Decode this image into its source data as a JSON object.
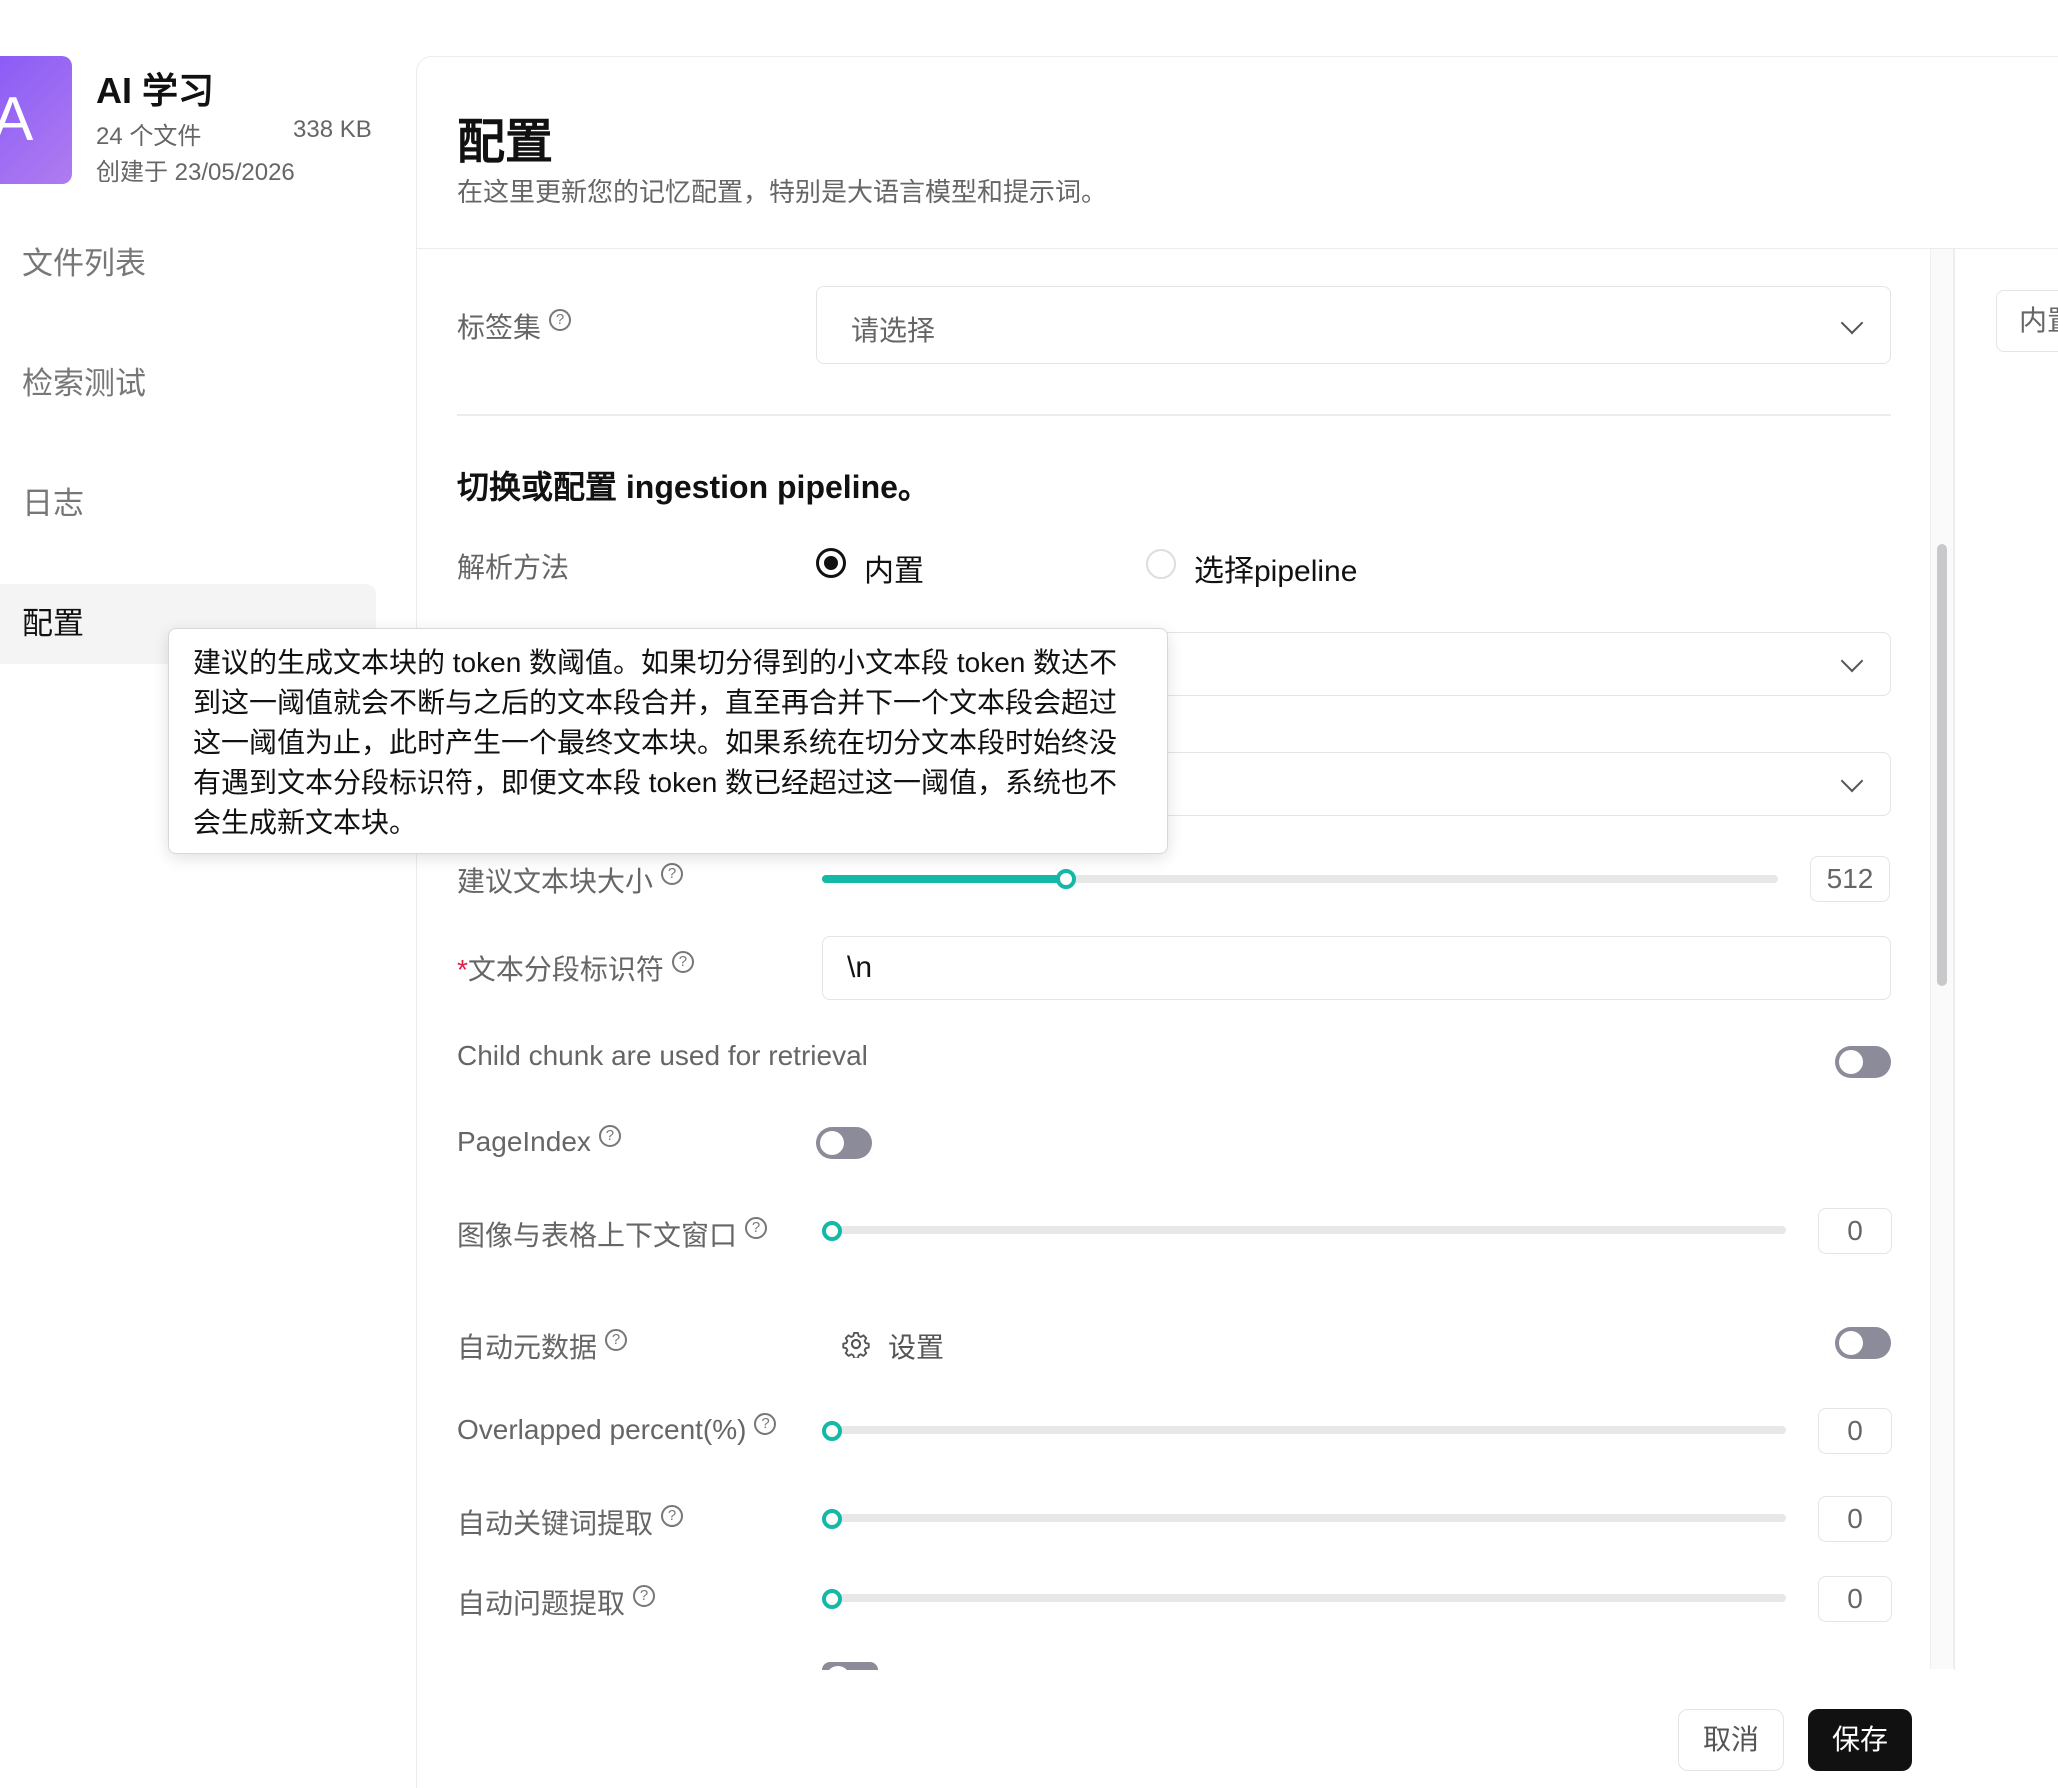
{
  "sidebar": {
    "avatar_letter": "A",
    "kb_title": "AI 学习",
    "file_count": "24 个文件",
    "size": "338 KB",
    "created": "创建于 23/05/2026",
    "items": [
      {
        "label": "文件列表",
        "active": false
      },
      {
        "label": "检索测试",
        "active": false
      },
      {
        "label": "日志",
        "active": false
      },
      {
        "label": "配置",
        "active": true
      }
    ]
  },
  "header": {
    "title": "配置",
    "description": "在这里更新您的记忆配置，特别是大语言模型和提示词。"
  },
  "right_panel": {
    "tab_label": "内置"
  },
  "form": {
    "tag_set": {
      "label": "标签集",
      "placeholder": "请选择"
    },
    "section_heading": "切换或配置 ingestion pipeline。",
    "parse_method": {
      "label": "解析方法",
      "options": [
        "内置",
        "选择pipeline"
      ],
      "selected": "内置"
    },
    "chunk_size": {
      "label": "建议文本块大小",
      "value": "512",
      "fraction": 0.25
    },
    "delimiter": {
      "required_mark": "*",
      "label": "文本分段标识符",
      "value": "\\n"
    },
    "child_chunk": {
      "label": "Child chunk are used for retrieval",
      "enabled": false
    },
    "page_index": {
      "label": "PageIndex",
      "enabled": false
    },
    "image_table_context": {
      "label": "图像与表格上下文窗口",
      "value": "0"
    },
    "auto_metadata": {
      "label": "自动元数据",
      "settings_label": "设置",
      "enabled": false
    },
    "overlapped_percent": {
      "label": "Overlapped percent(%)",
      "value": "0"
    },
    "auto_keywords": {
      "label": "自动关键词提取",
      "value": "0"
    },
    "auto_questions": {
      "label": "自动问题提取",
      "value": "0"
    }
  },
  "tooltip": {
    "text": "建议的生成文本块的 token 数阈值。如果切分得到的小文本段 token 数达不到这一阈值就会不断与之后的文本段合并，直至再合并下一个文本段会超过这一阈值为止，此时产生一个最终文本块。如果系统在切分文本段时始终没有遇到文本分段标识符，即便文本段 token 数已经超过这一阈值，系统也不会生成新文本块。"
  },
  "footer": {
    "cancel_label": "取消",
    "save_label": "保存"
  },
  "colors": {
    "accent": "#14b8a6",
    "primary_button": "#111111",
    "avatar_gradient": "#8b5cf6"
  },
  "icons": [
    "help-icon",
    "chevron-down-icon",
    "gear-icon"
  ]
}
